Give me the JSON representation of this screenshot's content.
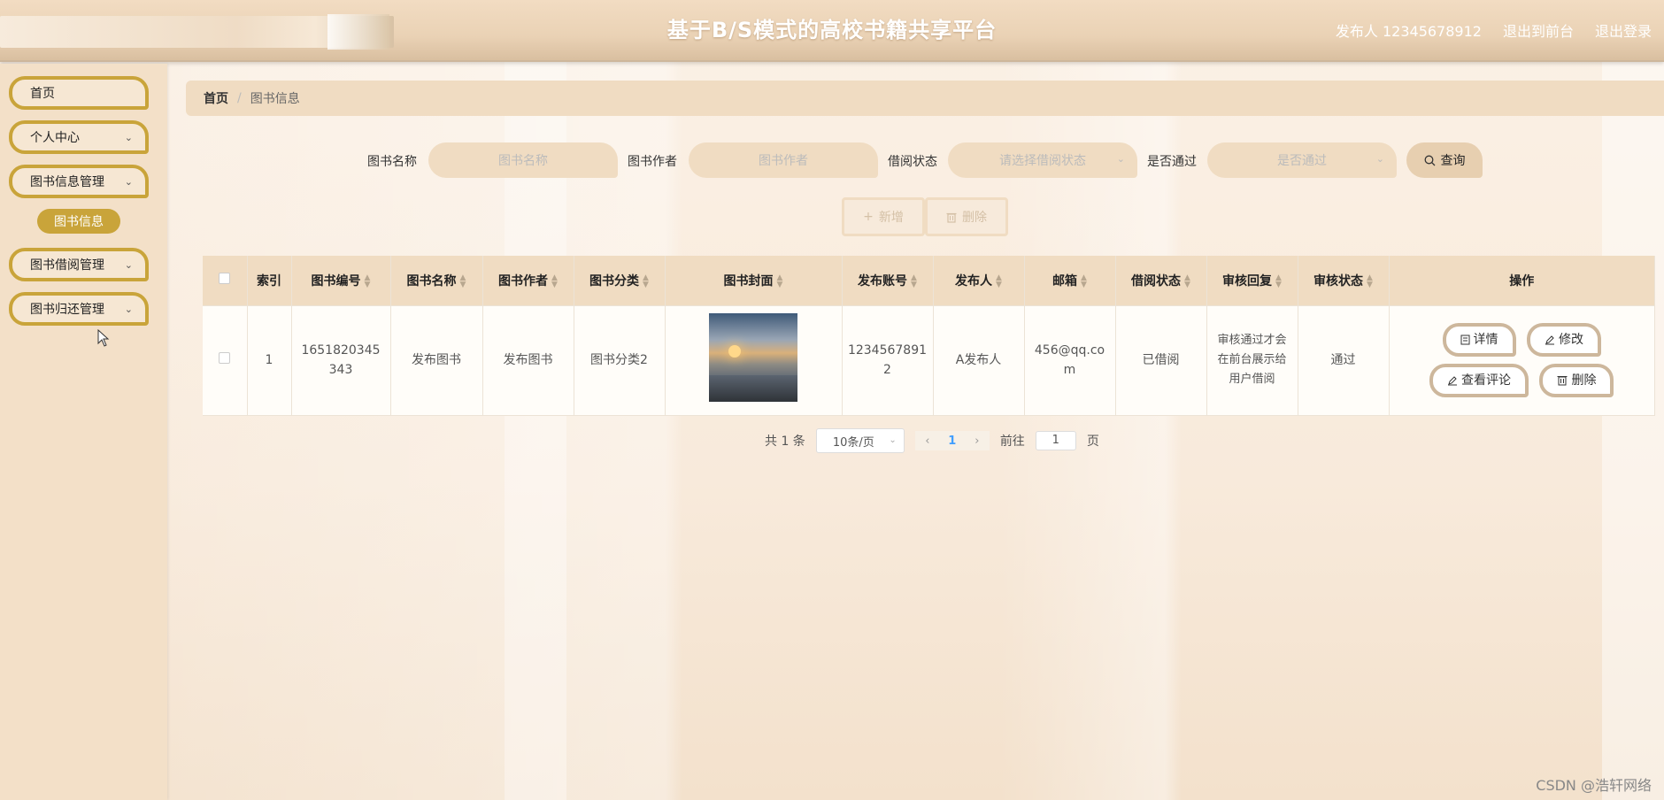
{
  "header": {
    "title": "基于B/S模式的高校书籍共享平台",
    "user": "发布人 12345678912",
    "exit_front": "退出到前台",
    "logout": "退出登录"
  },
  "sidebar": {
    "items": [
      {
        "label": "首页"
      },
      {
        "label": "个人中心"
      },
      {
        "label": "图书信息管理"
      },
      {
        "label": "图书借阅管理"
      },
      {
        "label": "图书归还管理"
      }
    ],
    "active_sub": "图书信息"
  },
  "breadcrumb": {
    "home": "首页",
    "separator": "/",
    "current": "图书信息"
  },
  "search": {
    "name_label": "图书名称",
    "name_placeholder": "图书名称",
    "author_label": "图书作者",
    "author_placeholder": "图书作者",
    "status_label": "借阅状态",
    "status_placeholder": "请选择借阅状态",
    "pass_label": "是否通过",
    "pass_placeholder": "是否通过",
    "query_label": "查询"
  },
  "toolbar": {
    "add_label": "新增",
    "delete_label": "删除"
  },
  "table": {
    "columns": [
      "索引",
      "图书编号",
      "图书名称",
      "图书作者",
      "图书分类",
      "图书封面",
      "发布账号",
      "发布人",
      "邮箱",
      "借阅状态",
      "审核回复",
      "审核状态",
      "操作"
    ],
    "rows": [
      {
        "index": "1",
        "book_no": "1651820345343",
        "book_name": "发布图书",
        "author": "发布图书",
        "category": "图书分类2",
        "account": "12345678912",
        "publisher": "A发布人",
        "email": "456@qq.com",
        "borrow_status": "已借阅",
        "review_reply": "审核通过才会在前台展示给用户借阅",
        "review_status": "通过"
      }
    ],
    "actions": {
      "detail": "详情",
      "edit": "修改",
      "comments": "查看评论",
      "delete": "删除"
    }
  },
  "pagination": {
    "total": "共 1 条",
    "page_size": "10条/页",
    "current_page": "1",
    "goto_prefix": "前往",
    "goto_value": "1",
    "goto_suffix": "页"
  },
  "watermark": "CSDN @浩轩网络",
  "colors": {
    "accent": "#c9a43a",
    "header_bg": "#ead2b5",
    "panel": "#f0dcc2"
  }
}
